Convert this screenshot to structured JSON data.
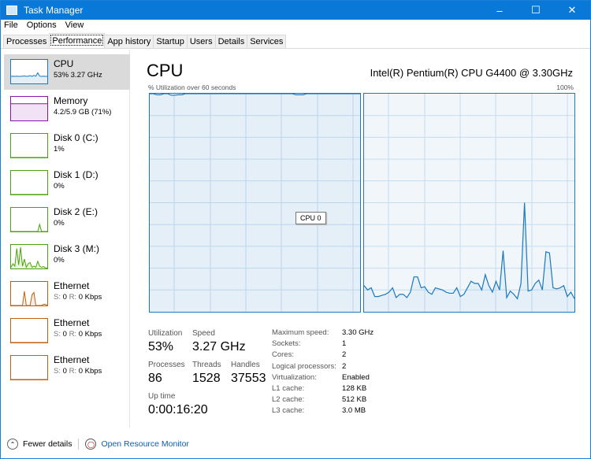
{
  "window": {
    "title": "Task Manager",
    "controls": [
      "minimize",
      "maximize",
      "close"
    ]
  },
  "menu": [
    "File",
    "Options",
    "View"
  ],
  "tabs": [
    "Processes",
    "Performance",
    "App history",
    "Startup",
    "Users",
    "Details",
    "Services"
  ],
  "active_tab": "Performance",
  "sidebar": [
    {
      "name": "CPU",
      "value": "53%  3.27 GHz",
      "color": "#1a78bd",
      "spark": [
        30,
        31,
        30,
        31,
        30,
        30,
        31,
        32,
        30,
        31,
        33,
        30,
        34,
        31,
        45,
        31,
        30,
        31,
        30,
        30
      ]
    },
    {
      "name": "Memory",
      "value": "4.2/5.9 GB (71%)",
      "color": "#8b12ae",
      "spark": [
        71,
        71,
        71,
        71,
        71,
        71,
        71,
        71,
        71,
        71,
        71,
        71,
        71,
        71,
        71,
        71,
        71,
        71,
        71,
        71
      ]
    },
    {
      "name": "Disk 0 (C:)",
      "value": "1%",
      "color": "#4ca20c",
      "spark": [
        0,
        0,
        0,
        0,
        0,
        0,
        0,
        0,
        0,
        0,
        0,
        0,
        0,
        0,
        0,
        0,
        0,
        0,
        0,
        0
      ]
    },
    {
      "name": "Disk 1 (D:)",
      "value": "0%",
      "color": "#4ca20c",
      "spark": [
        0,
        0,
        0,
        0,
        0,
        0,
        0,
        0,
        0,
        0,
        0,
        0,
        0,
        0,
        0,
        0,
        0,
        0,
        0,
        0
      ]
    },
    {
      "name": "Disk 2 (E:)",
      "value": "0%",
      "color": "#4ca20c",
      "spark": [
        0,
        0,
        0,
        0,
        0,
        0,
        0,
        0,
        0,
        0,
        0,
        0,
        0,
        0,
        0,
        30,
        0,
        0,
        0,
        0
      ]
    },
    {
      "name": "Disk 3 (M:)",
      "value": "0%",
      "color": "#4ca20c",
      "spark": [
        5,
        20,
        10,
        85,
        15,
        90,
        10,
        40,
        5,
        20,
        25,
        5,
        10,
        5,
        30,
        10,
        5,
        8,
        3,
        2
      ]
    },
    {
      "name": "Ethernet",
      "s_label": "S:",
      "s": "0",
      "r_label": "R:",
      "r": "0 Kbps",
      "color": "#c0600f",
      "spark": [
        0,
        0,
        0,
        0,
        0,
        0,
        0,
        60,
        0,
        0,
        0,
        45,
        55,
        0,
        0,
        0,
        0,
        5,
        5,
        0
      ]
    },
    {
      "name": "Ethernet",
      "s_label": "S:",
      "s": "0",
      "r_label": "R:",
      "r": "0 Kbps",
      "color": "#c0600f",
      "spark": [
        0,
        0,
        0,
        0,
        0,
        0,
        0,
        0,
        0,
        0,
        0,
        0,
        0,
        0,
        0,
        0,
        0,
        0,
        0,
        0
      ]
    },
    {
      "name": "Ethernet",
      "s_label": "S:",
      "s": "0",
      "r_label": "R:",
      "r": "0 Kbps",
      "color": "#c0600f",
      "spark": [
        0,
        0,
        0,
        0,
        0,
        0,
        0,
        0,
        0,
        0,
        0,
        0,
        0,
        0,
        0,
        0,
        0,
        0,
        0,
        0
      ]
    }
  ],
  "main": {
    "title": "CPU",
    "cpu_name": "Intel(R) Pentium(R) CPU G4400 @ 3.30GHz",
    "graph_label": "% Utilization over 60 seconds",
    "graph_max": "100%",
    "tooltip": "CPU 0",
    "graph_color": "#1a78bd",
    "grid_color": "#c5dcee",
    "fill_color": "#f1f6fb",
    "cpu0": [
      100,
      100,
      99.5,
      99.5,
      100,
      100,
      99.3,
      99.3,
      99.5,
      99.5,
      100,
      100,
      100,
      100,
      100,
      100,
      100,
      100,
      100,
      100,
      100,
      100,
      100,
      100,
      100,
      100,
      100,
      100,
      100,
      100,
      100,
      100,
      100,
      100,
      100,
      100,
      100,
      100,
      100,
      100,
      100,
      99.5,
      99.5,
      99.5,
      100,
      100,
      100,
      100,
      100,
      100,
      100,
      100,
      100,
      100,
      100,
      100,
      100,
      100,
      100,
      100
    ],
    "cpu1": [
      12,
      10,
      11,
      7,
      7,
      7.5,
      8,
      9,
      11,
      6.5,
      8,
      8,
      6.5,
      9,
      16,
      16,
      11,
      11.5,
      9,
      8,
      11,
      10.5,
      10,
      9,
      8.5,
      8.5,
      11,
      7,
      8,
      11,
      14,
      13,
      13,
      10,
      17,
      12,
      9,
      14,
      10,
      28,
      6.5,
      9.5,
      8,
      6,
      13,
      50,
      9.5,
      10,
      13,
      14.5,
      10,
      27.5,
      27,
      11,
      10.5,
      11,
      12,
      7,
      9,
      6
    ],
    "stats": {
      "utilization_label": "Utilization",
      "utilization": "53%",
      "speed_label": "Speed",
      "speed": "3.27 GHz",
      "processes_label": "Processes",
      "processes": "86",
      "threads_label": "Threads",
      "threads": "1528",
      "handles_label": "Handles",
      "handles": "37553",
      "uptime_label": "Up time",
      "uptime": "0:00:16:20"
    },
    "specs": [
      {
        "k": "Maximum speed:",
        "v": "3.30 GHz"
      },
      {
        "k": "Sockets:",
        "v": "1"
      },
      {
        "k": "Cores:",
        "v": "2"
      },
      {
        "k": "Logical processors:",
        "v": "2"
      },
      {
        "k": "Virtualization:",
        "v": "Enabled"
      },
      {
        "k": "L1 cache:",
        "v": "128 KB"
      },
      {
        "k": "L2 cache:",
        "v": "512 KB"
      },
      {
        "k": "L3 cache:",
        "v": "3.0 MB"
      }
    ]
  },
  "footer": {
    "fewer": "Fewer details",
    "monitor": "Open Resource Monitor"
  }
}
